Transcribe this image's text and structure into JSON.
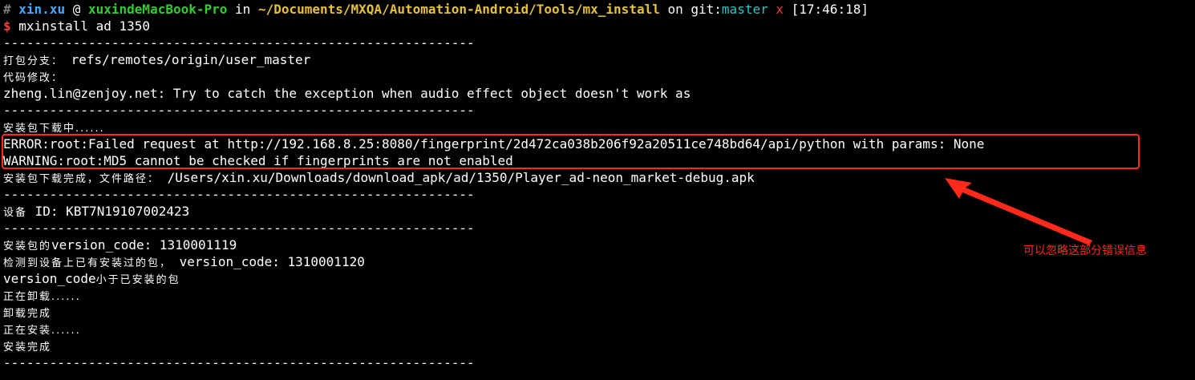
{
  "prompt_line": {
    "hash": "#",
    "user": "xin.xu",
    "at": "@",
    "host": "xuxindeMacBook-Pro",
    "in": "in",
    "path": "~/Documents/MXQA/Automation-Android/Tools/mx_install",
    "on": "on",
    "git_label": "git:",
    "branch": "master",
    "dirty": "x",
    "time": "[17:46:18]"
  },
  "command": {
    "symbol": "$",
    "text": "mxinstall ad 1350"
  },
  "separator": "-------------------------------------------------------------",
  "output": {
    "branch_label": "打包分支：",
    "branch_value": " refs/remotes/origin/user_master",
    "changes_label": "代码修改：",
    "commit_message": "zheng.lin@zenjoy.net: Try to catch the exception when audio effect object doesn't work as",
    "downloading": "安装包下载中......",
    "error_line": "ERROR:root:Failed request at http://192.168.8.25:8080/fingerprint/2d472ca038b206f92a20511ce748bd64/api/python with params: None",
    "warning_line": "WARNING:root:MD5 cannot be checked if fingerprints are not enabled",
    "download_done_label": "安装包下载完成，文件路径：",
    "download_done_path": " /Users/xin.xu/Downloads/download_apk/ad/1350/Player_ad-neon_market-debug.apk",
    "device_label": "设备",
    "device_id": " ID: KBT7N19107002423",
    "pkg_version_label": "安装包的",
    "pkg_version_value": "version_code: 1310001119",
    "detected_label": "检测到设备上已有安装过的包，",
    "detected_value": " version_code: 1310001120",
    "compare_prefix": "version_code",
    "compare_suffix": "小于已安装的包",
    "uninstalling": "正在卸载......",
    "uninstall_done": "卸载完成",
    "installing": "正在安装......",
    "install_done": "安装完成"
  },
  "annotation": {
    "text": "可以忽略这部分错误信息",
    "color": "#ff2a1a"
  },
  "colors": {
    "background": "#000000",
    "user": "#4aa9ff",
    "host": "#33cc33",
    "path": "#e5c13a",
    "branch": "#2fc6c6",
    "error": "#e8433e"
  }
}
